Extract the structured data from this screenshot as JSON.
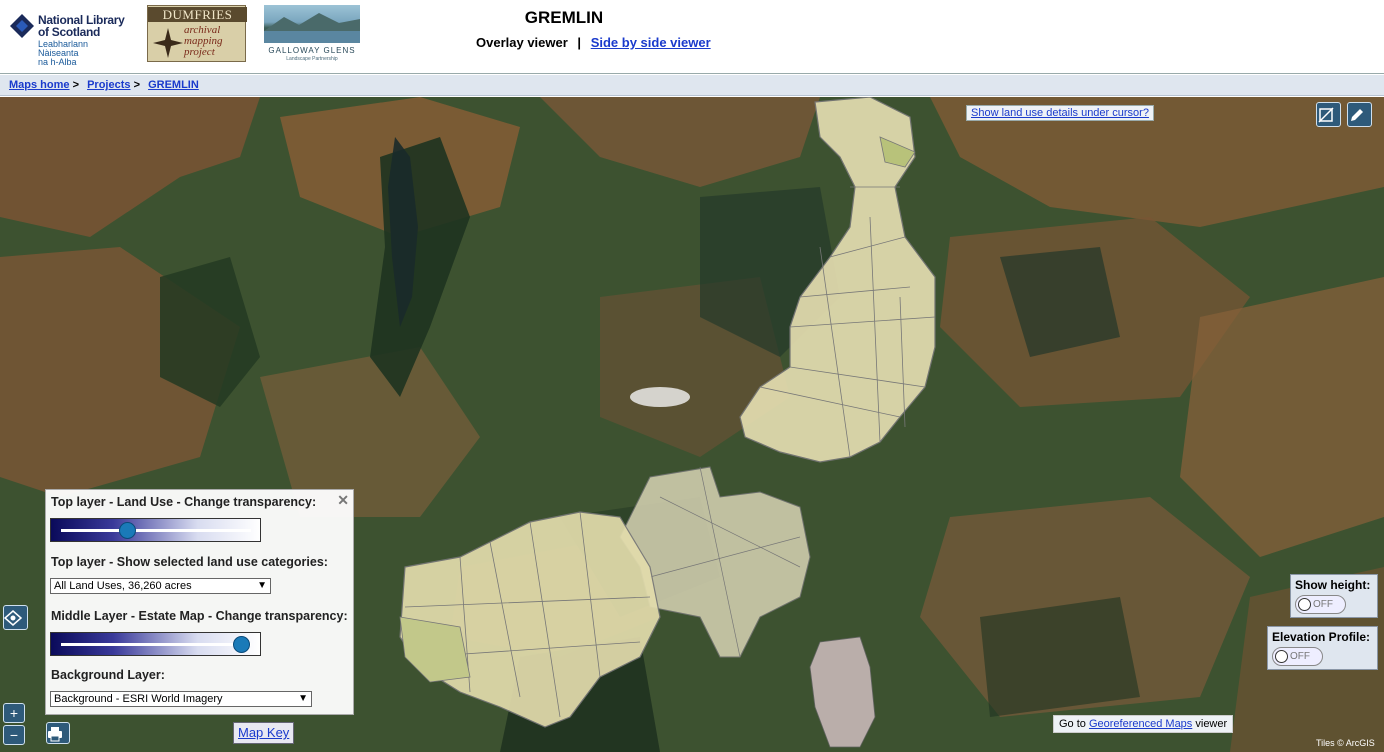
{
  "header": {
    "nls_logo": {
      "line1": "National Library",
      "line2": "of Scotland",
      "gaelic1": "Leabharlann Nàiseanta",
      "gaelic2": "na h-Alba"
    },
    "dumfries_logo": {
      "title": "DUMFRIES",
      "sub1": "archival",
      "sub2": "mapping",
      "sub3": "project"
    },
    "galloway_logo": {
      "title": "GALLOWAY GLENS",
      "subtitle": "Landscape Partnership"
    },
    "title": "GREMLIN",
    "viewer_current": "Overlay viewer",
    "viewer_separator": "|",
    "viewer_link": "Side by side viewer"
  },
  "breadcrumb": {
    "items": [
      {
        "label": "Maps home",
        "sep": ">"
      },
      {
        "label": "Projects",
        "sep": ">"
      },
      {
        "label": "GREMLIN",
        "sep": ""
      }
    ]
  },
  "map": {
    "landuse_cursor_button": "Show land use details under cursor?",
    "layer_panel": {
      "close": "✕",
      "top_transparency_label": "Top layer - Land Use - Change transparency:",
      "top_transparency_value": 0.35,
      "categories_label": "Top layer - Show selected land use categories:",
      "categories_selected": "All Land Uses, 36,260 acres",
      "middle_transparency_label": "Middle Layer - Estate Map - Change transparency:",
      "middle_transparency_value": 0.95,
      "background_label": "Background Layer:",
      "background_selected": "Background - ESRI World Imagery"
    },
    "show_height": {
      "label": "Show height:",
      "state": "OFF"
    },
    "elevation_profile": {
      "label": "Elevation Profile:",
      "state": "OFF"
    },
    "georef": {
      "prefix": "Go to",
      "link": "Georeferenced Maps",
      "suffix": "viewer"
    },
    "map_key": "Map Key",
    "zoom_in": "+",
    "zoom_out": "−",
    "attribution": "Tiles © ArcGIS",
    "colors": {
      "forest": "#2d4a26",
      "moor": "#8a5a34",
      "landuse_fill": "#e8e2b0",
      "urban": "#c8b8b8",
      "control_blue": "#2e5a7a"
    }
  }
}
